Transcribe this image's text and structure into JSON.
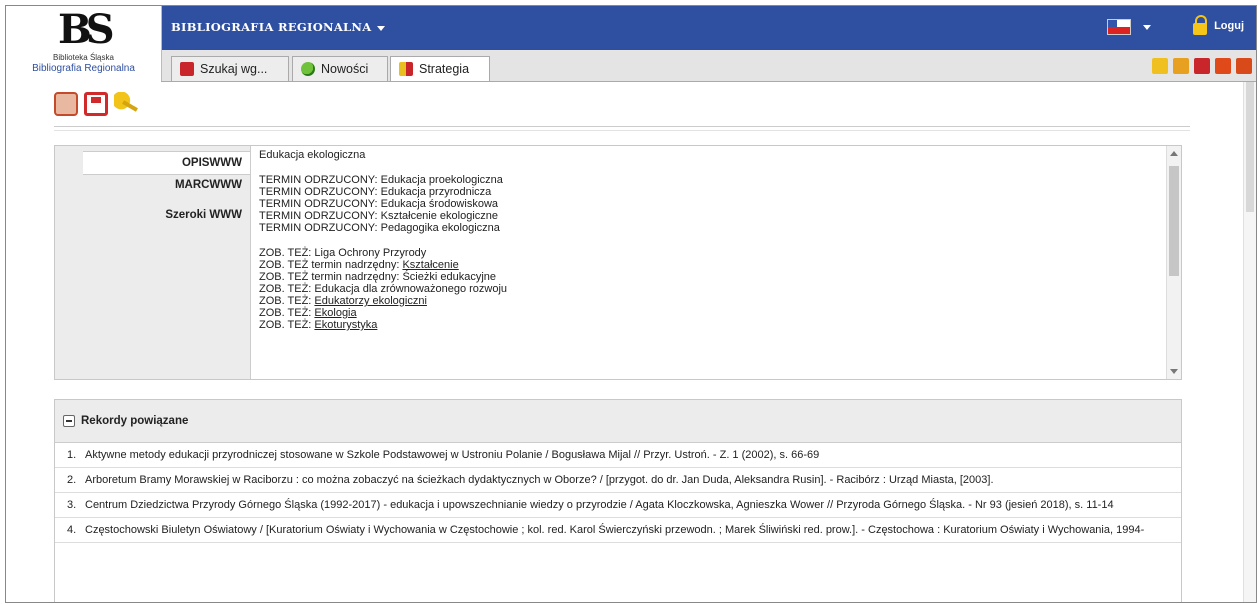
{
  "logo": {
    "mark": "BS",
    "small": "Biblioteka Śląska",
    "name": "Bibliografia Regionalna"
  },
  "header": {
    "title": "BIBLIOGRAFIA REGIONALNA",
    "login": "Loguj"
  },
  "tabs": [
    {
      "label": "Szukaj wg...",
      "icon": "search-icon"
    },
    {
      "label": "Nowości",
      "icon": "news-icon"
    },
    {
      "label": "Strategia",
      "icon": "strategy-icon"
    }
  ],
  "right_tools": [
    {
      "icon": "tool-1-icon",
      "color": "#f0c020"
    },
    {
      "icon": "tool-2-icon",
      "color": "#e8a020"
    },
    {
      "icon": "tool-3-icon",
      "color": "#c8262b"
    },
    {
      "icon": "tool-4-icon",
      "color": "#e04a1a"
    },
    {
      "icon": "tool-5-icon",
      "color": "#d84a1a"
    }
  ],
  "record_nav": [
    "OPISWWW",
    "MARCWWW",
    "Szeroki WWW"
  ],
  "record": {
    "heading": "Edukacja ekologiczna",
    "rejected": [
      "TERMIN ODRZUCONY: Edukacja proekologiczna",
      "TERMIN ODRZUCONY: Edukacja przyrodnicza",
      "TERMIN ODRZUCONY: Edukacja środowiskowa",
      "TERMIN ODRZUCONY: Kształcenie ekologiczne",
      "TERMIN ODRZUCONY: Pedagogika ekologiczna"
    ],
    "see_also": [
      {
        "prefix": "ZOB. TEŻ: ",
        "text": "Liga Ochrony Przyrody",
        "link": false
      },
      {
        "prefix": "ZOB. TEŻ termin nadrzędny: ",
        "text": "Kształcenie",
        "link": true
      },
      {
        "prefix": "ZOB. TEŻ termin nadrzędny: ",
        "text": "Ścieżki edukacyjne",
        "link": false
      },
      {
        "prefix": "ZOB. TEŻ: ",
        "text": "Edukacja dla zrównoważonego rozwoju",
        "link": false
      },
      {
        "prefix": "ZOB. TEŻ: ",
        "text": "Edukatorzy ekologiczni",
        "link": true
      },
      {
        "prefix": "ZOB. TEŻ: ",
        "text": "Ekologia",
        "link": true
      },
      {
        "prefix": "ZOB. TEŻ: ",
        "text": "Ekoturystyka",
        "link": true
      }
    ]
  },
  "related": {
    "title": "Rekordy powiązane",
    "items": [
      {
        "num": "1.",
        "text": "Aktywne metody edukacji przyrodniczej stosowane w Szkole Podstawowej w Ustroniu Polanie / Bogusława Mijal // Przyr. Ustroń. - Z. 1 (2002), s. 66-69"
      },
      {
        "num": "2.",
        "text": "Arboretum Bramy Morawskiej w Raciborzu : co można zobaczyć na ścieżkach dydaktycznych w Oborze? / [przygot. do dr. Jan Duda, Aleksandra Rusin]. - Racibórz : Urząd Miasta, [2003]."
      },
      {
        "num": "3.",
        "text": "Centrum Dziedzictwa Przyrody Górnego Śląska (1992-2017) - edukacja i upowszechnianie wiedzy o przyrodzie / Agata Kloczkowska, Agnieszka Wower // Przyroda Górnego Śląska. - Nr 93 (jesień 2018), s. 11-14"
      },
      {
        "num": "4.",
        "text": "Częstochowski Biuletyn Oświatowy / [Kuratorium Oświaty i Wychowania w Częstochowie ; kol. red. Karol Świerczyński przewodn. ; Marek Śliwiński red. prow.]. - Częstochowa : Kuratorium Oświaty i Wychowania, 1994-"
      }
    ]
  }
}
